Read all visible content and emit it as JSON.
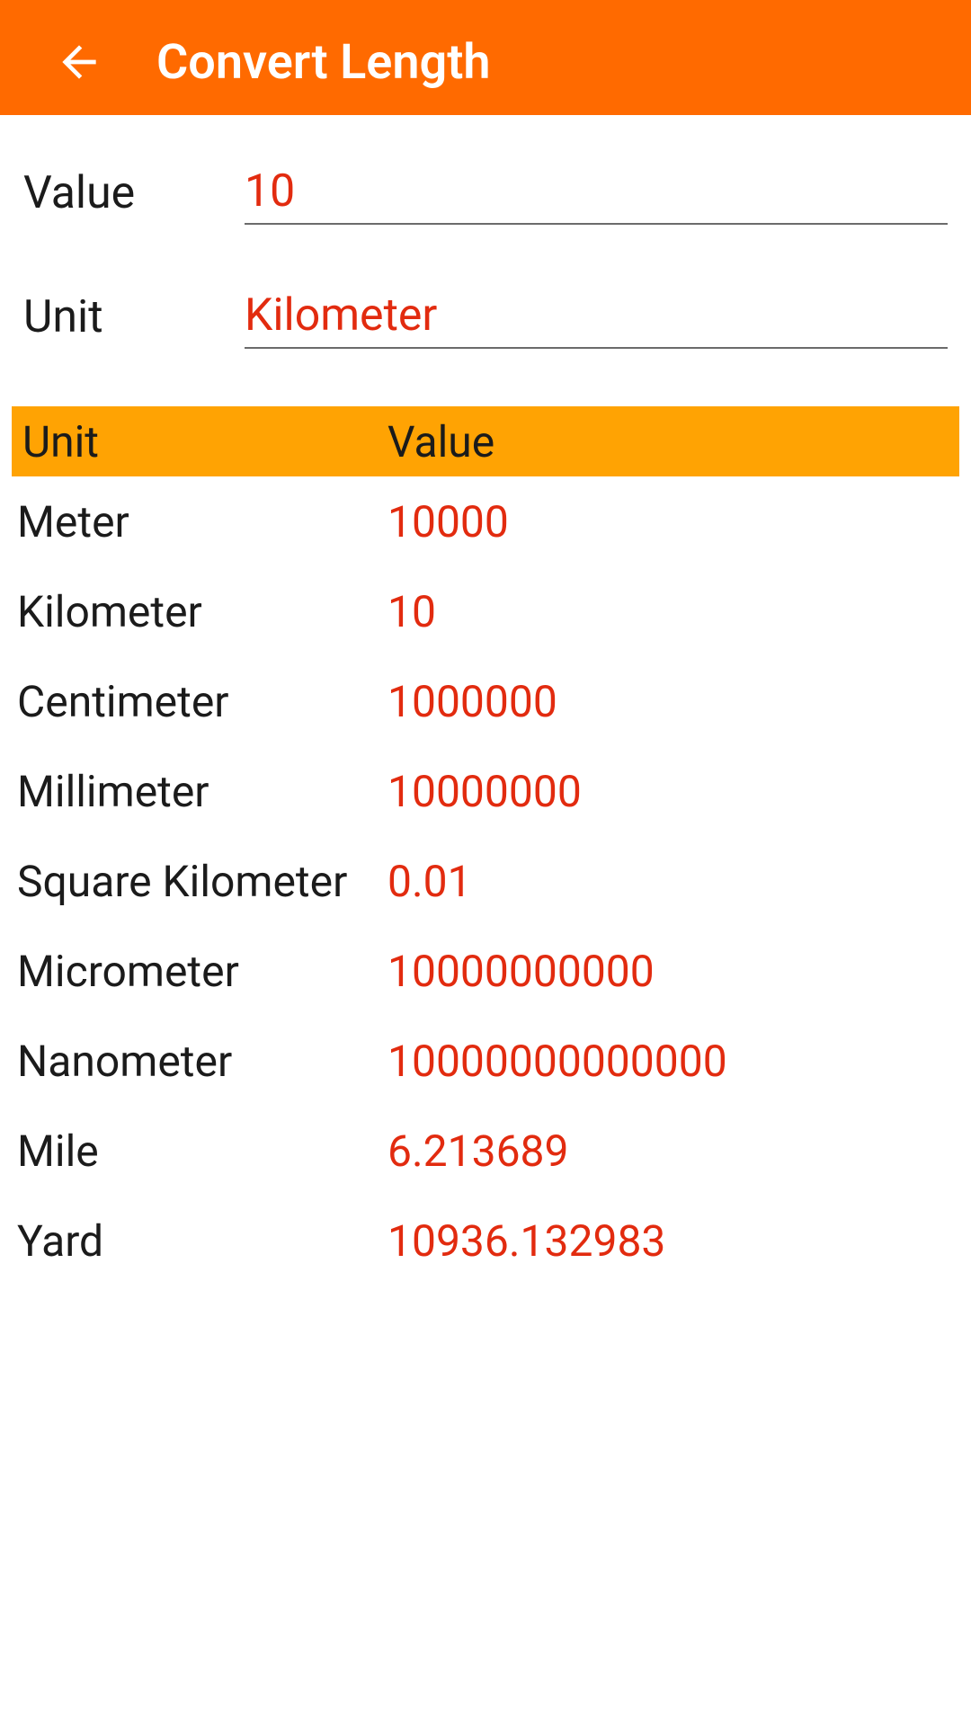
{
  "header": {
    "title": "Convert Length"
  },
  "form": {
    "value_label": "Value",
    "value_input": "10",
    "unit_label": "Unit",
    "unit_selected": "Kilometer"
  },
  "table": {
    "header_unit": "Unit",
    "header_value": "Value",
    "rows": [
      {
        "unit": "Meter",
        "value": "10000"
      },
      {
        "unit": "Kilometer",
        "value": "10"
      },
      {
        "unit": "Centimeter",
        "value": "1000000"
      },
      {
        "unit": "Millimeter",
        "value": "10000000"
      },
      {
        "unit": "Square Kilometer",
        "value": "0.01"
      },
      {
        "unit": "Micrometer",
        "value": "10000000000"
      },
      {
        "unit": "Nanometer",
        "value": "10000000000000"
      },
      {
        "unit": "Mile",
        "value": "6.213689"
      },
      {
        "unit": "Yard",
        "value": "10936.132983"
      }
    ]
  }
}
